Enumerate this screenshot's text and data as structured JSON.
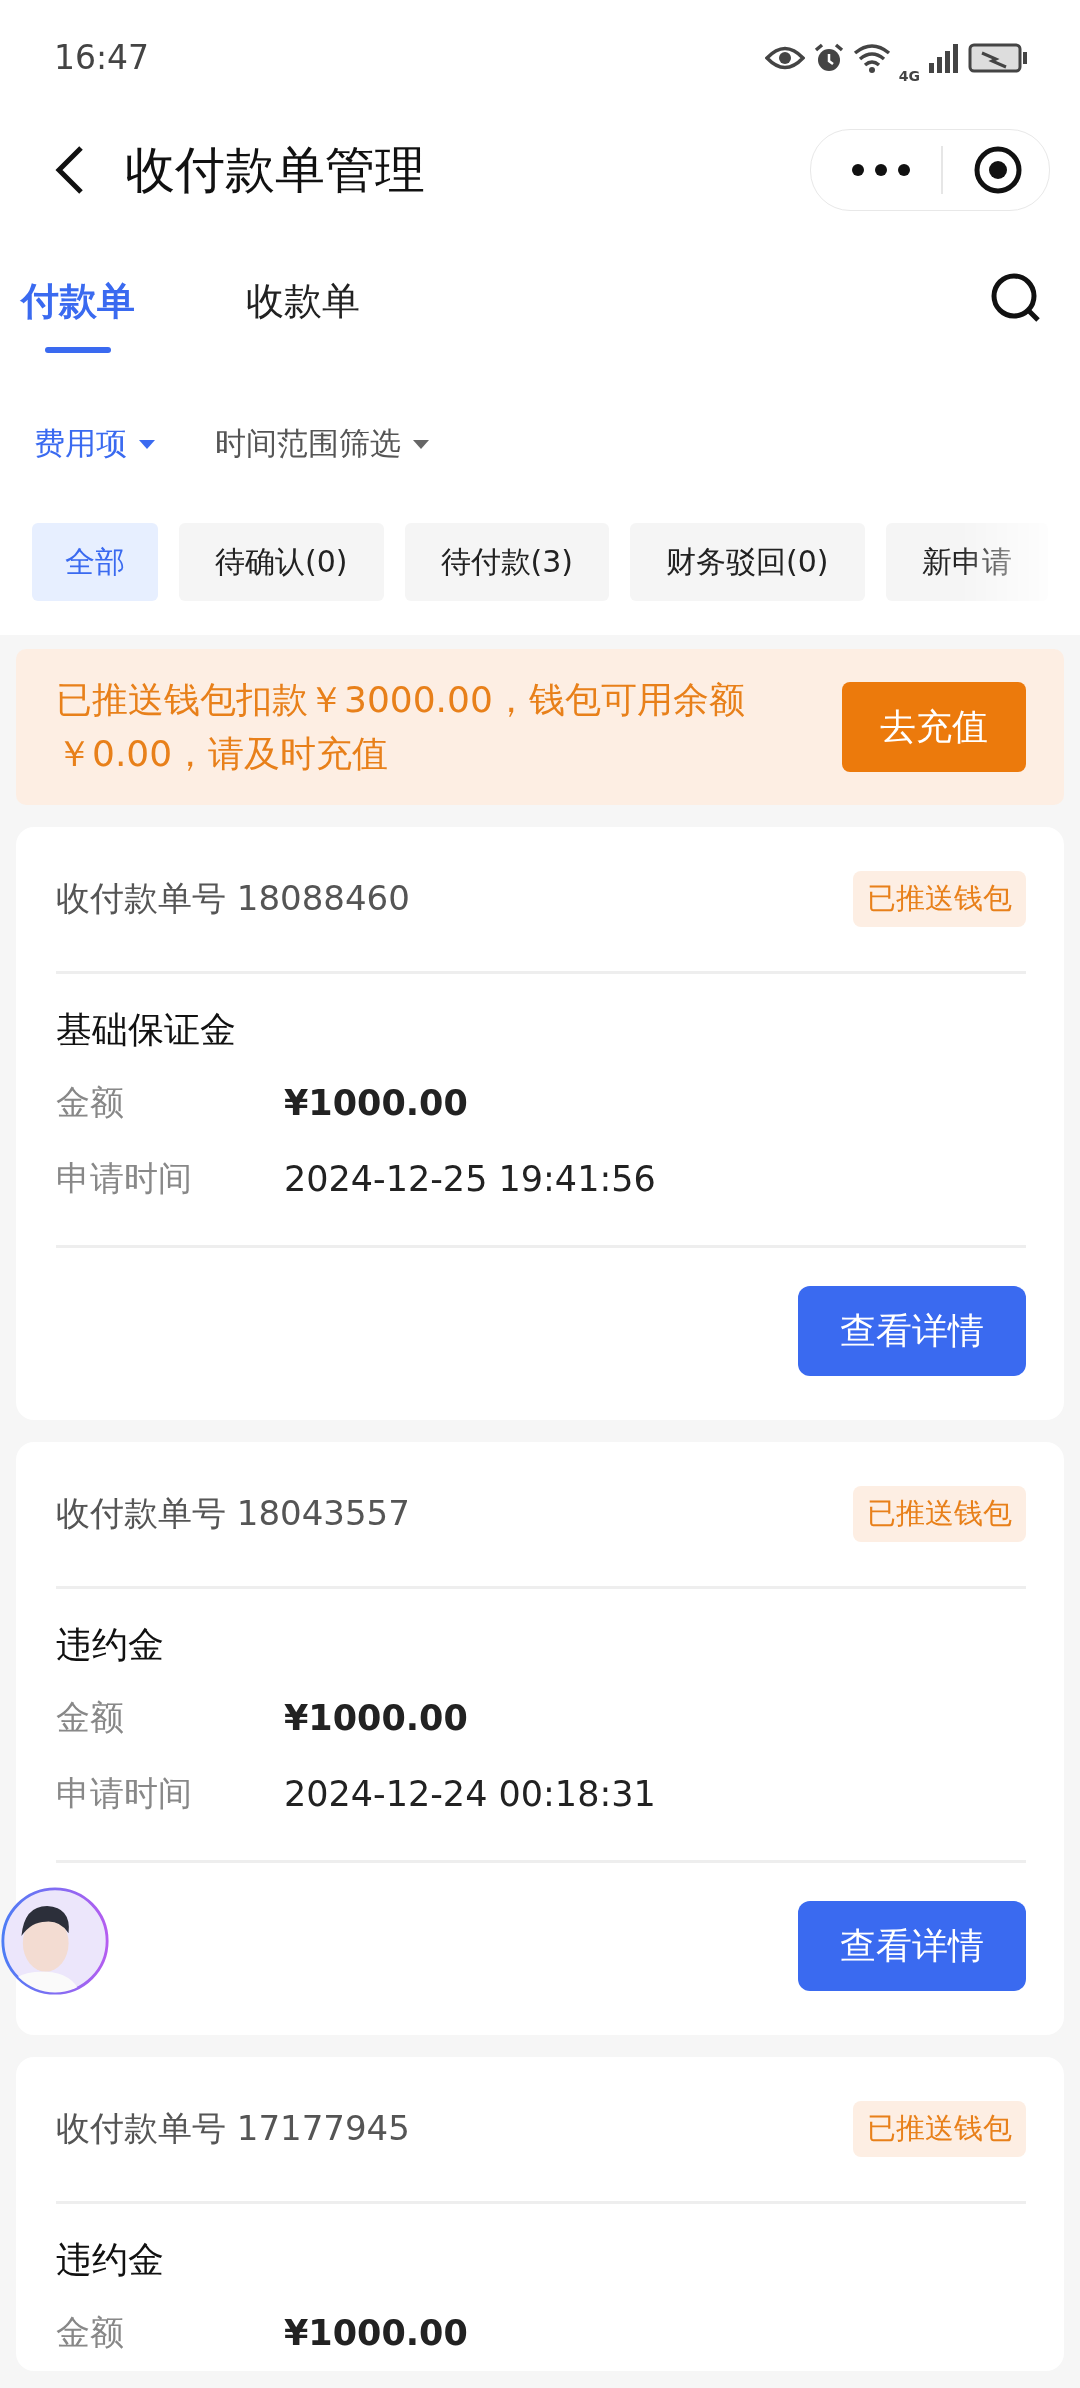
{
  "status_bar": {
    "time": "16:47",
    "network": "4G"
  },
  "header": {
    "title": "收付款单管理"
  },
  "tabs": [
    {
      "label": "付款单",
      "selected": true
    },
    {
      "label": "收款单",
      "selected": false
    }
  ],
  "filters": [
    {
      "label": "费用项",
      "selected": true
    },
    {
      "label": "时间范围筛选",
      "selected": false
    }
  ],
  "chips": [
    {
      "label": "全部",
      "selected": true
    },
    {
      "label": "待确认(0)",
      "selected": false
    },
    {
      "label": "待付款(3)",
      "selected": false
    },
    {
      "label": "财务驳回(0)",
      "selected": false
    },
    {
      "label": "新申请",
      "selected": false
    }
  ],
  "notice": {
    "text": "已推送钱包扣款￥3000.00，钱包可用余额￥0.00，请及时充值",
    "button": "去充值"
  },
  "cards": [
    {
      "order_label": "收付款单号",
      "order_no": "18088460",
      "status": "已推送钱包",
      "title": "基础保证金",
      "rows": [
        {
          "label": "金额",
          "value": "¥1000.00",
          "kind": "amount"
        },
        {
          "label": "申请时间",
          "value": "2024-12-25 19:41:56",
          "kind": "time"
        }
      ],
      "button": "查看详情"
    },
    {
      "order_label": "收付款单号",
      "order_no": "18043557",
      "status": "已推送钱包",
      "title": "违约金",
      "rows": [
        {
          "label": "金额",
          "value": "¥1000.00",
          "kind": "amount"
        },
        {
          "label": "申请时间",
          "value": "2024-12-24 00:18:31",
          "kind": "time"
        }
      ],
      "button": "查看详情"
    },
    {
      "order_label": "收付款单号",
      "order_no": "17177945",
      "status": "已推送钱包",
      "title": "违约金",
      "rows": [
        {
          "label": "金额",
          "value": "¥1000.00",
          "kind": "amount"
        }
      ]
    }
  ]
}
